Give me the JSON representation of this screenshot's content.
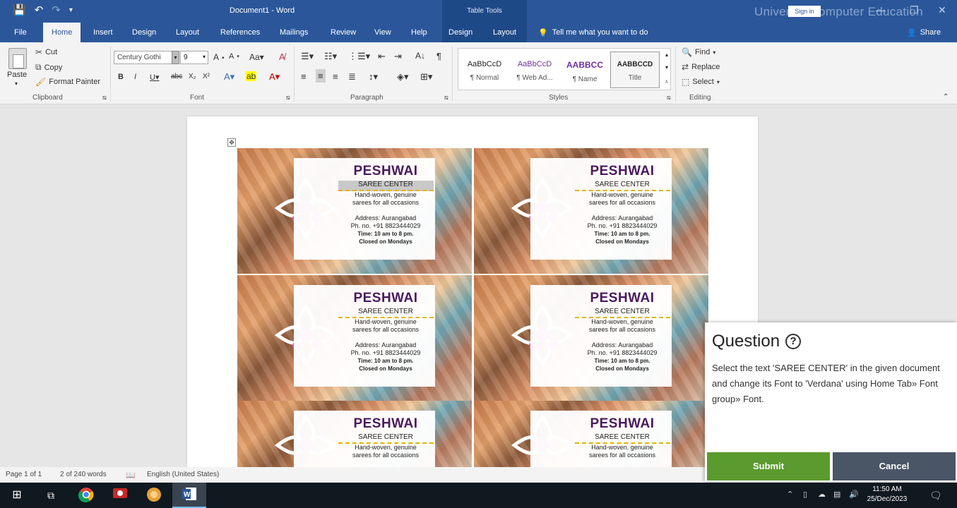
{
  "titlebar": {
    "doc_title": "Document1 - Word",
    "contextual_group": "Table Tools",
    "watermark": "Universal Computer Education",
    "signin": "Sign in",
    "minimize": "—",
    "restore": "❐",
    "close": "✕"
  },
  "tabs": [
    "File",
    "Home",
    "Insert",
    "Design",
    "Layout",
    "References",
    "Mailings",
    "Review",
    "View",
    "Help",
    "Design",
    "Layout"
  ],
  "tellme": "Tell me what you want to do",
  "share": "Share",
  "ribbon": {
    "clipboard": {
      "label": "Clipboard",
      "paste": "Paste",
      "cut": "Cut",
      "copy": "Copy",
      "format_painter": "Format Painter"
    },
    "font": {
      "label": "Font",
      "font_name": "Century Gothi",
      "font_size": "9"
    },
    "paragraph": {
      "label": "Paragraph"
    },
    "styles": {
      "label": "Styles",
      "items": [
        {
          "sample": "AaBbCcD",
          "name": "¶ Normal"
        },
        {
          "sample": "AaBbCcD",
          "name": "¶ Web Ad..."
        },
        {
          "sample": "AABBCC",
          "name": "¶ Name"
        },
        {
          "sample": "AABBCCD",
          "name": "Title"
        }
      ]
    },
    "editing": {
      "label": "Editing",
      "find": "Find",
      "replace": "Replace",
      "select": "Select"
    }
  },
  "cards": [
    {
      "title": "PESHWAI",
      "subtitle": "SAREE CENTER",
      "line1": "Hand-woven, genuine",
      "line2": "sarees for all occasions",
      "addr": "Address: Aurangabad",
      "phone": "Ph. no. +91 8823444029",
      "time": "Time: 10 am to 8 pm.",
      "closed": "Closed on Mondays"
    },
    {
      "title": "PESHWAI",
      "subtitle": "SAREE CENTER",
      "line1": "Hand-woven, genuine",
      "line2": "sarees for all occasions",
      "addr": "Address: Aurangabad",
      "phone": "Ph. no. +91 8823444029",
      "time": "Time: 10 am to 8 pm.",
      "closed": "Closed on Mondays"
    },
    {
      "title": "PESHWAI",
      "subtitle": "SAREE CENTER",
      "line1": "Hand-woven, genuine",
      "line2": "sarees for all occasions",
      "addr": "Address: Aurangabad",
      "phone": "Ph. no. +91 8823444029",
      "time": "Time: 10 am to 8 pm.",
      "closed": "Closed on Mondays"
    },
    {
      "title": "PESHWAI",
      "subtitle": "SAREE CENTER",
      "line1": "Hand-woven, genuine",
      "line2": "sarees for all occasions",
      "addr": "Address: Aurangabad",
      "phone": "Ph. no. +91 8823444029",
      "time": "Time: 10 am to 8 pm.",
      "closed": "Closed on Mondays"
    },
    {
      "title": "PESHWAI",
      "subtitle": "SAREE CENTER",
      "line1": "Hand-woven, genuine",
      "line2": "sarees for all occasions"
    },
    {
      "title": "PESHWAI",
      "subtitle": "SAREE CENTER",
      "line1": "Hand-woven, genuine",
      "line2": "sarees for all occasions"
    }
  ],
  "statusbar": {
    "page": "Page 1 of 1",
    "words": "2 of 240 words",
    "language": "English (United States)"
  },
  "question": {
    "title": "Question",
    "text": "Select the text 'SAREE CENTER' in the given document and change its Font to 'Verdana' using Home Tab» Font group» Font.",
    "submit": "Submit",
    "cancel": "Cancel"
  },
  "taskbar": {
    "time": "11:50 AM",
    "date": "25/Dec/2023"
  },
  "colors": {
    "word_blue": "#2b579a",
    "submit_green": "#5b9a2e",
    "cancel_gray": "#4a5566",
    "card_title": "#4a1a5c"
  }
}
